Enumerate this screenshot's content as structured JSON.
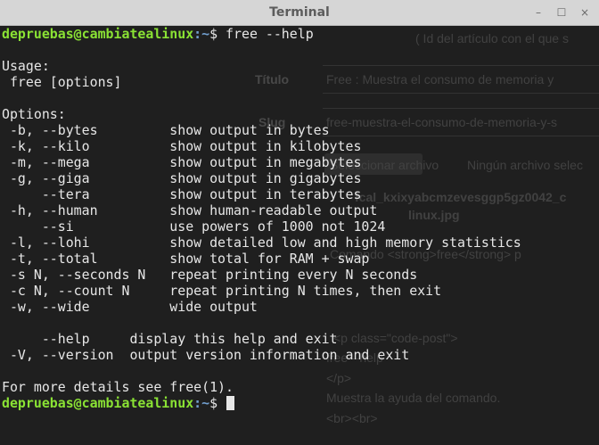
{
  "window": {
    "title": "Terminal",
    "controls": {
      "minimize": "–",
      "maximize": "☐",
      "close": "×"
    }
  },
  "terminal": {
    "prompt": {
      "user_host": "depruebas@cambiatealinux",
      "path_sep": ":~",
      "symbol": "$"
    },
    "command": "free --help",
    "output_lines": [
      "",
      "Usage:",
      " free [options]",
      "",
      "Options:",
      " -b, --bytes         show output in bytes",
      " -k, --kilo          show output in kilobytes",
      " -m, --mega          show output in megabytes",
      " -g, --giga          show output in gigabytes",
      "     --tera          show output in terabytes",
      " -h, --human         show human-readable output",
      "     --si            use powers of 1000 not 1024",
      " -l, --lohi          show detailed low and high memory statistics",
      " -t, --total         show total for RAM + swap",
      " -s N, --seconds N   repeat printing every N seconds",
      " -c N, --count N     repeat printing N times, then exit",
      " -w, --wide          wide output",
      "",
      "     --help     display this help and exit",
      " -V, --version  output version information and exit",
      "",
      "For more details see free(1)."
    ]
  },
  "background_page": {
    "id_hint": "( Id del artículo con el que s",
    "title_label": "Título",
    "title_value": "Free : Muestra el consumo de memoria y",
    "slug_label": "Slug",
    "slug_value": "free-muestra-el-consumo-de-memoria-y-s",
    "file_button": "Seleccionar archivo",
    "file_status": "Ningún archivo selec",
    "image_name": "fcal_kxixyabcmzevesggp5gz0042_c",
    "image_name_2": "linux.jpg",
    "desc_value": "Comando <strong>free</strong> p",
    "code_1": "<p class=\"code-post\">",
    "code_2": "free --help",
    "code_3": "</p>",
    "code_4": "Muestra la ayuda del comando.",
    "code_5": "<br><br>"
  },
  "colors": {
    "prompt_user": "#8ae234",
    "prompt_path": "#729fcf",
    "text": "#e7e7e7",
    "background": "#1e1e1e"
  }
}
